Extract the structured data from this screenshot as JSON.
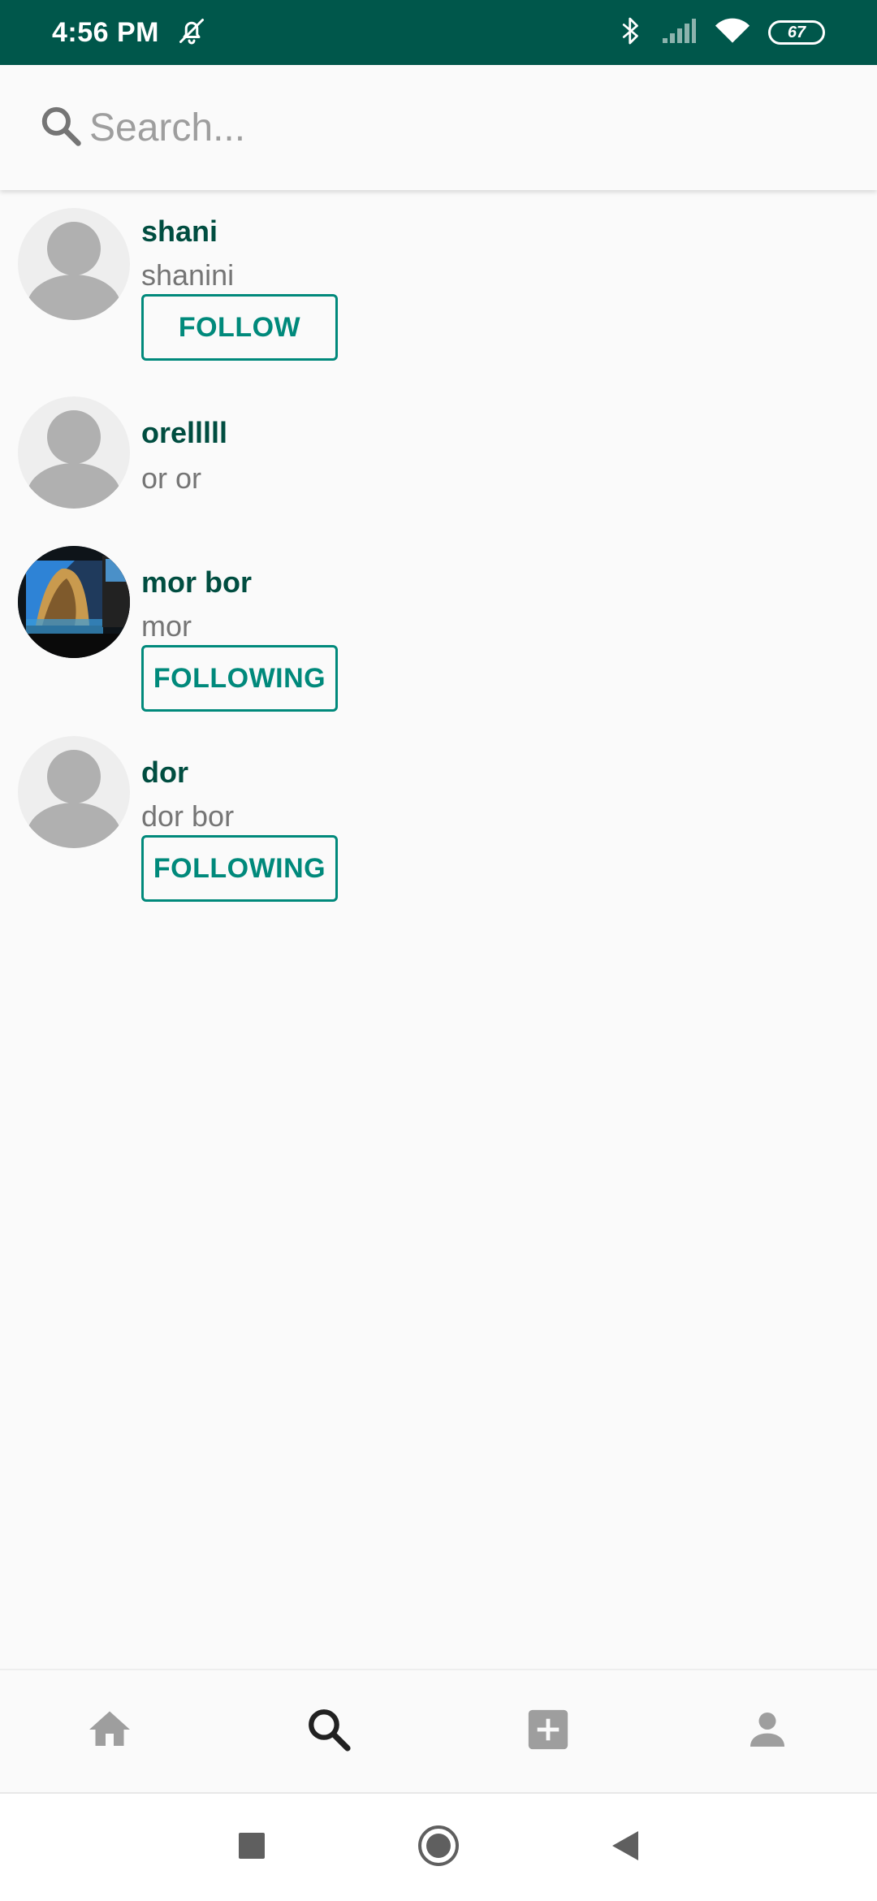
{
  "status_bar": {
    "time": "4:56 PM",
    "battery": "67",
    "icons": [
      "mute-bell-icon",
      "bluetooth-icon",
      "signal-icon",
      "wifi-icon",
      "battery-icon"
    ]
  },
  "search": {
    "placeholder": "Search...",
    "value": "",
    "icon": "search-icon"
  },
  "users": [
    {
      "name": "shani",
      "handle": "shanini",
      "button": "FOLLOW",
      "avatar": "default-avatar-icon"
    },
    {
      "name": "orelllll",
      "handle": "or or",
      "button": "",
      "avatar": "default-avatar-icon"
    },
    {
      "name": "mor bor",
      "handle": "mor",
      "button": "FOLLOWING",
      "avatar": "photo-avatar"
    },
    {
      "name": "dor",
      "handle": "dor bor",
      "button": "FOLLOWING",
      "avatar": "default-avatar-icon"
    }
  ],
  "bottom_nav": {
    "items": [
      {
        "id": "home",
        "icon": "home-icon",
        "active": false
      },
      {
        "id": "search",
        "icon": "search-icon",
        "active": true
      },
      {
        "id": "add-post",
        "icon": "add-box-icon",
        "active": false
      },
      {
        "id": "profile",
        "icon": "person-icon",
        "active": false
      }
    ]
  },
  "colors": {
    "status_bar": "#00574b",
    "primary": "#00897b",
    "name_text": "#004d40",
    "secondary_text": "#757575",
    "inactive_icon": "#9e9e9e",
    "active_icon": "#212121"
  }
}
